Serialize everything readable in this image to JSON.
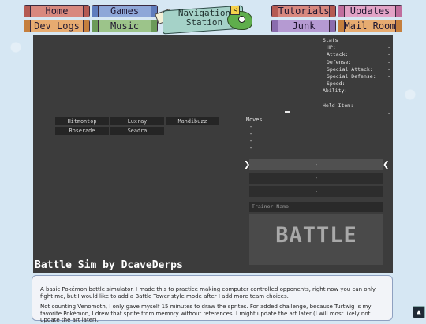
{
  "nav": {
    "left": [
      {
        "label": "Home",
        "color": "red"
      },
      {
        "label": "Games",
        "color": "blue"
      },
      {
        "label": "Dev Logs",
        "color": "orange"
      },
      {
        "label": "Music",
        "color": "green"
      }
    ],
    "station_label_line1": "Navigation",
    "station_label_line2": "Station",
    "right": [
      {
        "label": "Tutorials",
        "color": "red"
      },
      {
        "label": "Updates",
        "color": "pink"
      },
      {
        "label": "Junk",
        "color": "purple"
      },
      {
        "label": "Mail Room",
        "color": "orange"
      }
    ]
  },
  "stats": {
    "heading": "Stats",
    "rows": [
      {
        "label": "HP:",
        "value": "-"
      },
      {
        "label": "Attack:",
        "value": "-"
      },
      {
        "label": "Defense:",
        "value": "-"
      },
      {
        "label": "Special Attack:",
        "value": "-"
      },
      {
        "label": "Special Defense:",
        "value": "-"
      },
      {
        "label": "Speed:",
        "value": "-"
      }
    ],
    "ability_label": "Ability:",
    "ability_value": "-",
    "held_item_label": "Held Item:",
    "held_item_value": "-"
  },
  "team": [
    "Hitmontop",
    "Luxray",
    "Mandibuzz",
    "Roserade",
    "Seadra"
  ],
  "moves": {
    "heading": "Moves",
    "items": [
      "-",
      "-",
      "-",
      "-"
    ]
  },
  "slots": [
    "-",
    "-",
    "-"
  ],
  "arrows": {
    "left": "❯",
    "right": "❮"
  },
  "trainer_placeholder": "Trainer Name",
  "battle_label": "BATTLE",
  "game_title": "Battle Sim by DcaveDerps",
  "description": [
    "A basic Pokémon battle simulator. I made this to practice making computer controlled opponents, right now you can only fight me, but I would like to add a Battle Tower style mode after I add more team choices.",
    "Not counting Venomoth, I only gave myself 15 minutes to draw the sprites. For added challenge, because Turtwig is my favorite Pokémon, I drew that sprite from memory without references. I might update the art later (I will most likely not update the art later)."
  ],
  "colors": {
    "frame_bg": "#3c3c3c",
    "page_bg": "#d6e7f3"
  }
}
